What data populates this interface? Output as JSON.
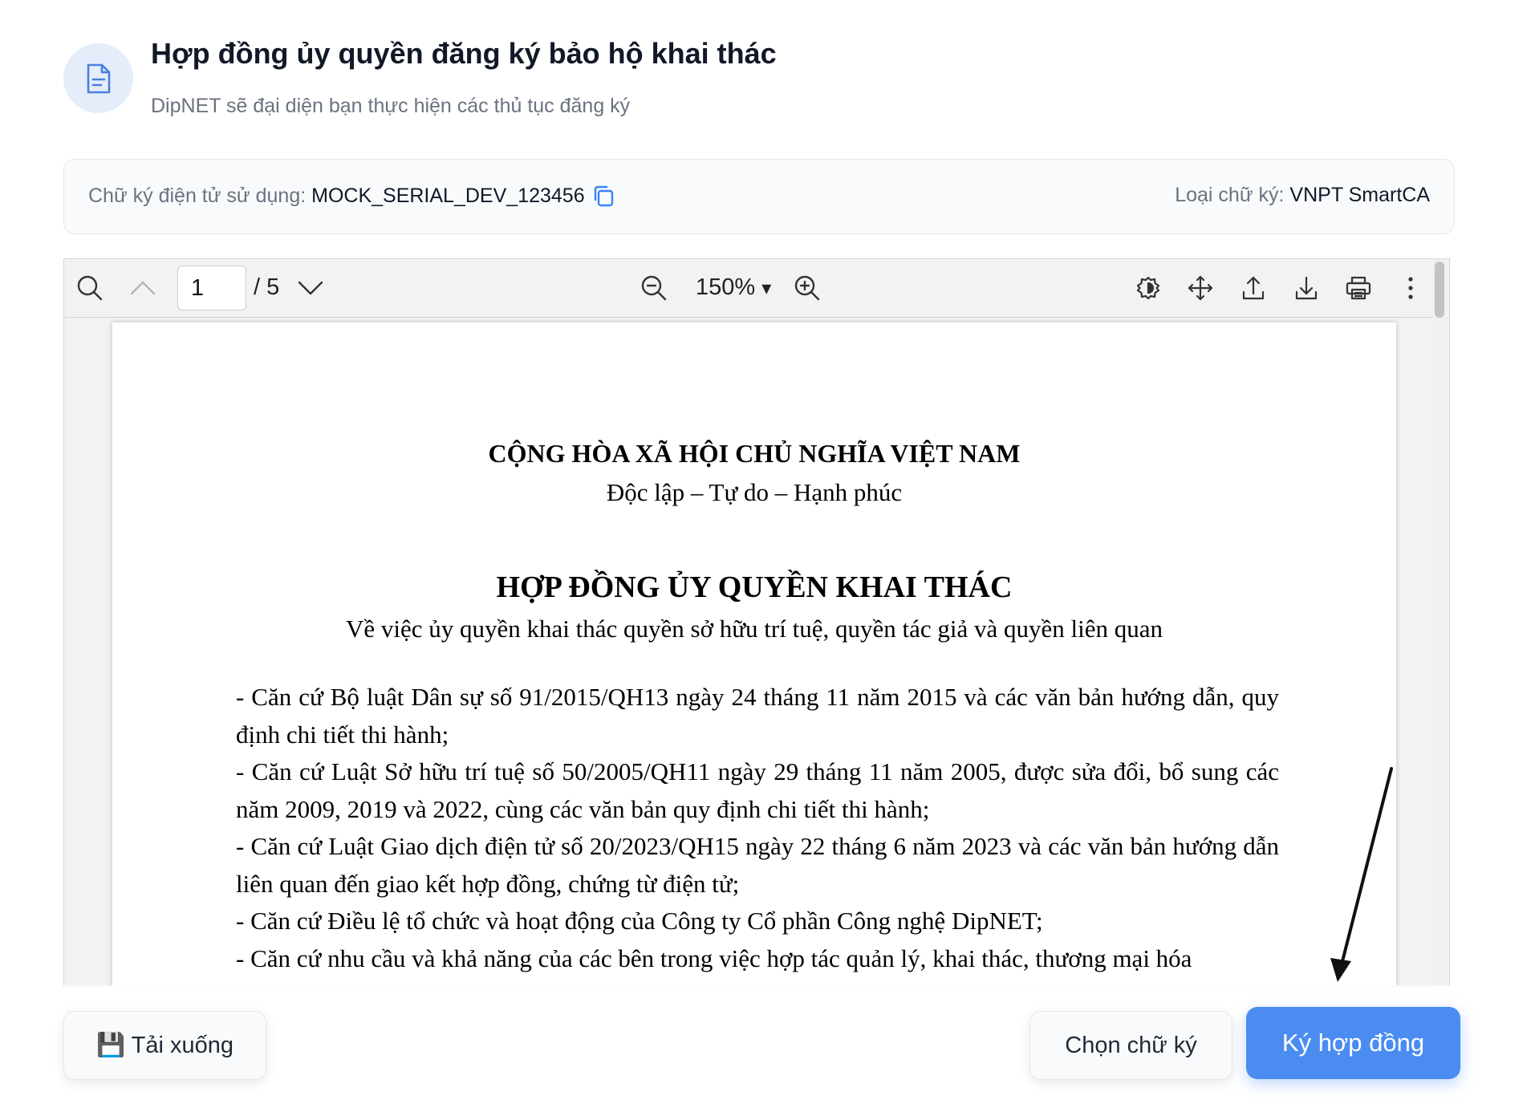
{
  "header": {
    "title": "Hợp đồng ủy quyền đăng ký bảo hộ khai thác",
    "subtitle": "DipNET sẽ đại diện bạn thực hiện các thủ tục đăng ký",
    "icon": "document-icon"
  },
  "signature_info": {
    "cert_label": "Chữ ký điện tử sử dụng:",
    "cert_value": "MOCK_SERIAL_DEV_123456",
    "type_label": "Loại chữ ký:",
    "type_value": "VNPT SmartCA"
  },
  "viewer": {
    "current_page": "1",
    "total_pages": "/ 5",
    "zoom": "150%",
    "zoom_caret": "▾"
  },
  "document": {
    "nation": "CỘNG HÒA XÃ HỘI CHỦ NGHĨA VIỆT NAM",
    "motto": "Độc lập – Tự do – Hạnh phúc",
    "title": "HỢP ĐỒNG ỦY QUYỀN KHAI THÁC",
    "subject": "Về việc ủy quyền khai thác quyền sở hữu trí tuệ, quyền tác giả và quyền liên quan",
    "clauses": [
      "- Căn cứ Bộ luật Dân sự số 91/2015/QH13 ngày 24 tháng 11 năm 2015 và các văn bản hướng dẫn, quy định chi tiết thi hành;",
      "- Căn cứ Luật Sở hữu trí tuệ số 50/2005/QH11 ngày 29 tháng 11 năm 2005, được sửa đổi, bổ sung các năm 2009, 2019 và 2022, cùng các văn bản quy định chi tiết thi hành;",
      "- Căn cứ Luật Giao dịch điện tử số 20/2023/QH15 ngày 22 tháng 6 năm 2023 và các văn bản hướng dẫn liên quan đến giao kết hợp đồng, chứng từ điện tử;",
      "- Căn cứ Điều lệ tổ chức và hoạt động của Công ty Cổ phần Công nghệ DipNET;",
      "- Căn cứ nhu cầu và khả năng của các bên trong việc hợp tác quản lý, khai thác, thương mại hóa"
    ]
  },
  "actions": {
    "download_label": "💾 Tải xuống",
    "choose_signature_label": "Chọn chữ ký",
    "sign_label": "Ký hợp đồng"
  },
  "colors": {
    "primary": "#4a8cf0",
    "icon_bg": "#e5edfb"
  }
}
